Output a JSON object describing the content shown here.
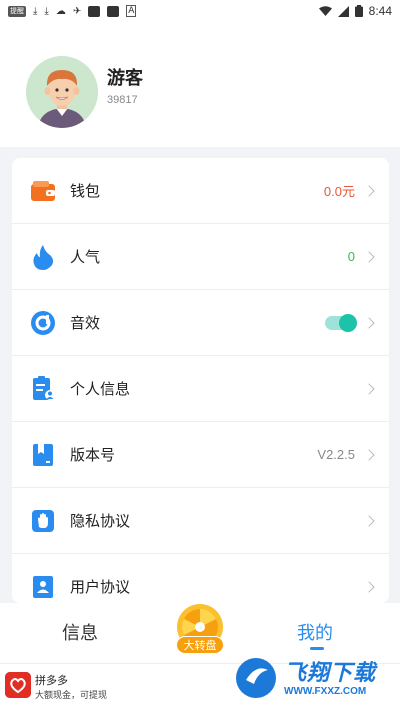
{
  "status_bar": {
    "left_badge": "提醒",
    "time": "8:44",
    "icons": [
      "download-icon",
      "download-icon",
      "cloud-icon",
      "android-icon",
      "app-icon",
      "app-icon",
      "a-icon"
    ]
  },
  "profile": {
    "name": "游客",
    "id": "39817"
  },
  "menu": [
    {
      "label": "钱包",
      "value": "0.0元",
      "value_color": "#e8573a",
      "icon": "wallet-icon"
    },
    {
      "label": "人气",
      "value": "0",
      "value_color": "#3cb85a",
      "icon": "flame-icon"
    },
    {
      "label": "音效",
      "toggle_on": true,
      "icon": "sound-icon"
    },
    {
      "label": "个人信息",
      "icon": "profile-doc-icon"
    },
    {
      "label": "版本号",
      "value": "V2.2.5",
      "value_color": "#888888",
      "icon": "bookmark-icon"
    },
    {
      "label": "隐私协议",
      "icon": "hand-icon"
    },
    {
      "label": "用户协议",
      "icon": "user-agreement-icon"
    }
  ],
  "tabbar": {
    "info": "信息",
    "wheel": "大转盘",
    "mine": "我的",
    "accent": "#2b8cf0"
  },
  "ad": {
    "title": "拼多多",
    "subtitle": "大额现金，可提现"
  },
  "watermark": {
    "text": "飞翔下载",
    "url": "WWW.FXXZ.COM"
  }
}
